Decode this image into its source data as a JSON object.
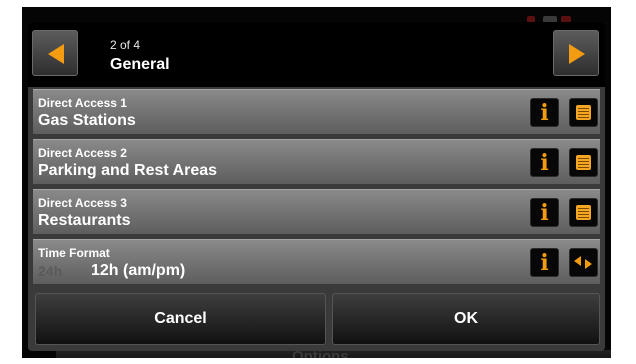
{
  "header": {
    "page_indicator": "2 of 4",
    "title": "General"
  },
  "rows": [
    {
      "label": "Direct Access 1",
      "value": "Gas Stations"
    },
    {
      "label": "Direct Access 2",
      "value": "Parking and Rest Areas"
    },
    {
      "label": "Direct Access 3",
      "value": "Restaurants"
    },
    {
      "label": "Time Format",
      "inactive_option": "24h",
      "value": "12h (am/pm)"
    }
  ],
  "footer": {
    "cancel_label": "Cancel",
    "ok_label": "OK"
  },
  "background": {
    "footer_text": "Options"
  },
  "colors": {
    "accent": "#f39c12",
    "row_bg": "#7a7a7a",
    "header_bg": "#000000"
  }
}
